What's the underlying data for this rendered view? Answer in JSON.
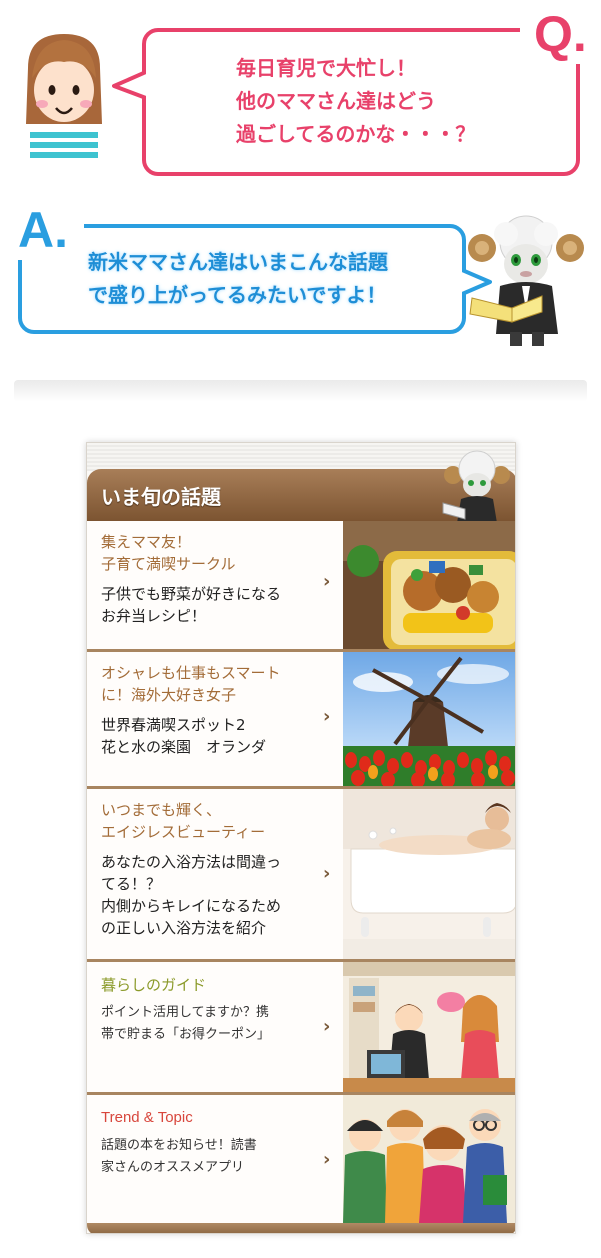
{
  "question": {
    "badge": "Q.",
    "lines": [
      "毎日育児で大忙し！",
      "他のママさん達はどう",
      "過ごしてるのかな・・・？"
    ]
  },
  "answer": {
    "badge": "A.",
    "lines": [
      "新米ママさん達はいまこんな話題",
      "で盛り上がってるみたいですよ！"
    ]
  },
  "panel": {
    "title": "いま旬の話題",
    "items": [
      {
        "category": [
          "集えママ友！",
          "子育て満喫サークル"
        ],
        "desc": [
          "子供でも野菜が好きになる",
          "お弁当レシピ！"
        ],
        "arrow": "›",
        "image": "bento-lunch-photo"
      },
      {
        "category": [
          "オシャレも仕事もスマート",
          "に！海外大好き女子"
        ],
        "desc": [
          "世界春満喫スポット2",
          "花と水の楽園　オランダ"
        ],
        "arrow": "›",
        "image": "windmill-tulip-photo"
      },
      {
        "category": [
          "いつまでも輝く、",
          "エイジレスビューティー"
        ],
        "desc": [
          "あなたの入浴方法は間違っ",
          "てる！？",
          "内側からキレイになるため",
          "の正しい入浴方法を紹介"
        ],
        "arrow": "›",
        "image": "bathtub-woman-photo"
      },
      {
        "category": [
          "暮らしのガイド"
        ],
        "desc": [
          "ポイント活用してますか？携",
          "帯で貯まる「お得クーポン」"
        ],
        "arrow": "›",
        "image": "shopping-illustration"
      },
      {
        "category": [
          "Trend & Topic"
        ],
        "desc": [
          "話題の本をお知らせ！読書",
          "家さんのオススメアプリ"
        ],
        "arrow": "›",
        "image": "crowd-illustration"
      }
    ]
  },
  "colors": {
    "question_pink": "#e8416a",
    "answer_blue": "#2a9ee0",
    "header_brown": "#8f6640",
    "category_brown": "#a36c38",
    "category_green": "#8b9a2a",
    "category_red": "#d8463c"
  }
}
